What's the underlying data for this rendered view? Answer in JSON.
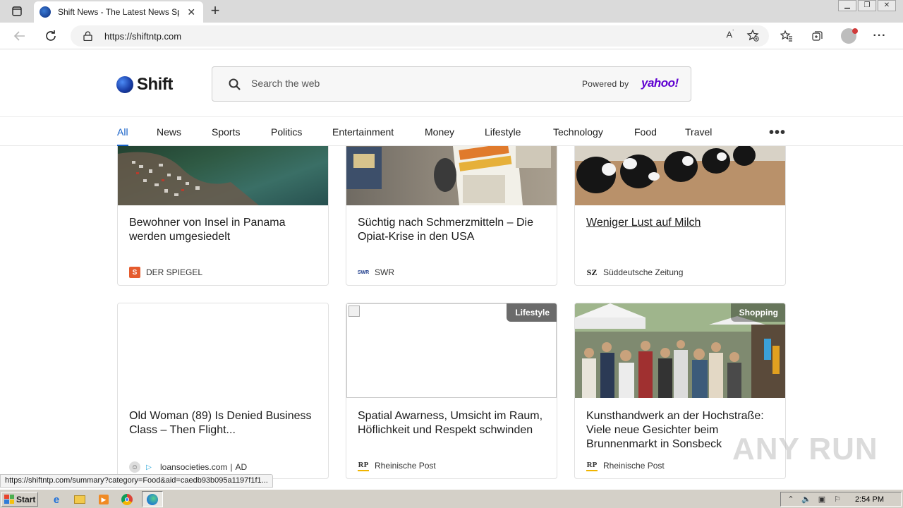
{
  "browser": {
    "tab_title": "Shift News - The Latest News Spc",
    "url": "https://shiftntp.com",
    "status_url": "https://shiftntp.com/summary?category=Food&aid=caedb93b095a1197f1f1..."
  },
  "header": {
    "logo_text": "Shift",
    "search_placeholder": "Search the web",
    "powered_by": "Powered by",
    "search_provider": "yahoo!"
  },
  "categories": [
    "All",
    "News",
    "Sports",
    "Politics",
    "Entertainment",
    "Money",
    "Lifestyle",
    "Technology",
    "Food",
    "Travel"
  ],
  "active_category": "All",
  "cards": [
    {
      "title": "Bewohner von Insel in Panama werden umgesiedelt",
      "source": "DER SPIEGEL",
      "image": "aerial-island-photo"
    },
    {
      "title": "Süchtig nach Schmerzmitteln – Die Opiat-Krise in den USA",
      "source": "SWR",
      "image": "newspaper-naloxone-photo"
    },
    {
      "title": "Weniger Lust auf Milch",
      "source": "Süddeutsche Zeitung",
      "image": "cows-photo"
    },
    {
      "title": "Old Woman (89) Is Denied Business Class – Then Flight...",
      "source": "loansocieties.com",
      "ad_label": "AD",
      "image": "blank"
    },
    {
      "title": "Spatial Awarness, Umsicht im Raum, Höflichkeit und Respekt schwinden",
      "source": "Rheinische Post",
      "badge": "Lifestyle",
      "image": "broken-image"
    },
    {
      "title": "Kunsthandwerk an der Hochstraße: Viele neue Gesichter beim Brunnenmarkt in Sonsbeck",
      "source": "Rheinische Post",
      "badge": "Shopping",
      "image": "market-crowd-photo"
    }
  ],
  "taskbar": {
    "start_label": "Start",
    "clock": "2:54 PM"
  },
  "watermark": "ANY RUN",
  "colors": {
    "accent": "#1560c7",
    "yahoo": "#5f01d1"
  }
}
